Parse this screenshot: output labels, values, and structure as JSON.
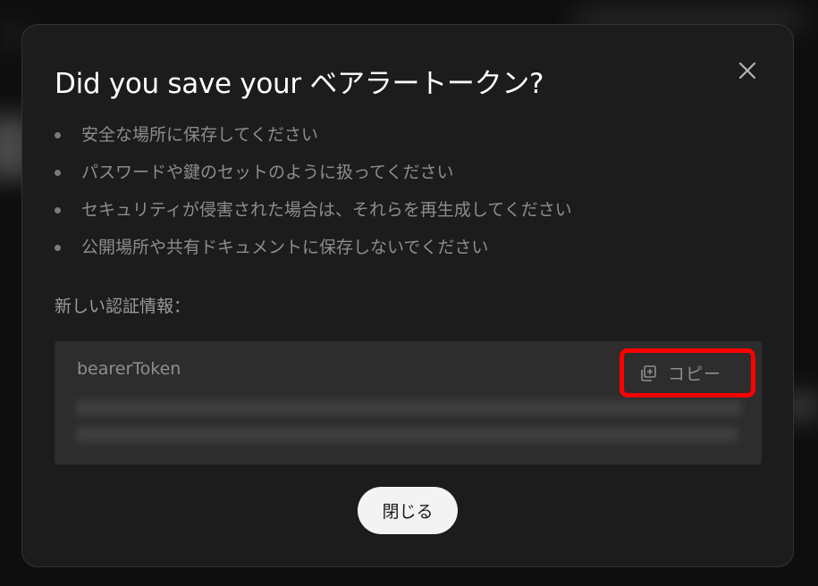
{
  "dialog": {
    "title": "Did you save your ベアラートークン?",
    "bullets": [
      "安全な場所に保存してください",
      "パスワードや鍵のセットのように扱ってください",
      "セキュリティが侵害された場合は、それらを再生成してください",
      "公開場所や共有ドキュメントに保存しないでください"
    ],
    "credentials_label": "新しい認証情報：",
    "token": {
      "name": "bearerToken",
      "copy_label": "コピー",
      "copy_icon": "copy-plus-icon",
      "value_state": "blurred"
    },
    "close_button_label": "閉じる",
    "close_icon": "close-icon"
  },
  "colors": {
    "dialog_background": "#1c1c1c",
    "token_box_background": "#2d2d2d",
    "highlight_border": "#ff0000",
    "close_button_background": "#f3f3f3"
  }
}
